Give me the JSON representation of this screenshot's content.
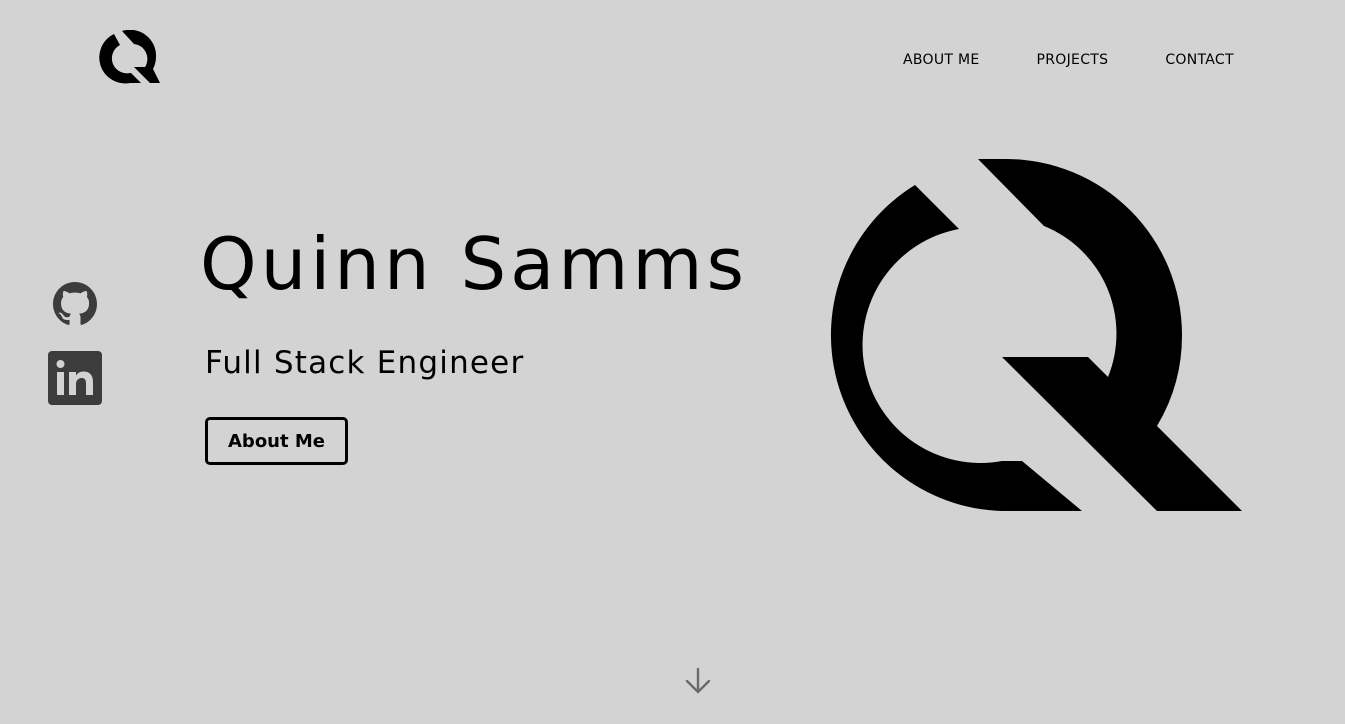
{
  "brand": {
    "logo_icon": "q-monogram-logo"
  },
  "nav": {
    "items": [
      {
        "label": "ABOUT ME"
      },
      {
        "label": "PROJECTS"
      },
      {
        "label": "CONTACT"
      }
    ]
  },
  "socials": {
    "items": [
      {
        "icon": "github-icon"
      },
      {
        "icon": "linkedin-icon"
      }
    ]
  },
  "hero": {
    "name": "Quinn Samms",
    "role": "Full Stack Engineer",
    "cta_label": "About Me",
    "logo_icon": "q-monogram-logo"
  },
  "scroll": {
    "icon": "arrow-down-icon"
  },
  "colors": {
    "background": "#d3d3d3",
    "foreground": "#000000",
    "social_icon": "#3c3c3c",
    "arrow": "#6a6a6a"
  }
}
